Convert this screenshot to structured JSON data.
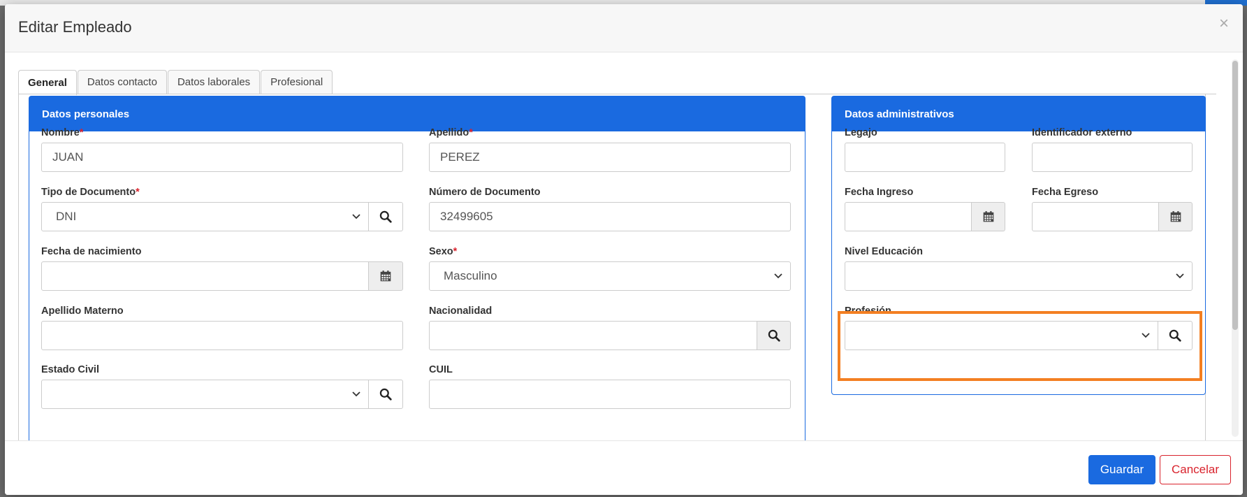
{
  "modal": {
    "title": "Editar Empleado",
    "close": "×"
  },
  "tabs": [
    "General",
    "Datos contacto",
    "Datos laborales",
    "Profesional"
  ],
  "personal": {
    "title": "Datos personales",
    "nombre": {
      "label": "Nombre",
      "required": "*",
      "value": "JUAN"
    },
    "apellido": {
      "label": "Apellido",
      "required": "*",
      "value": "PEREZ"
    },
    "tipo_documento": {
      "label": "Tipo de Documento",
      "required": "*",
      "value": "DNI"
    },
    "numero_documento": {
      "label": "Número de Documento",
      "value": "32499605"
    },
    "fecha_nacimiento": {
      "label": "Fecha de nacimiento",
      "value": ""
    },
    "sexo": {
      "label": "Sexo",
      "required": "*",
      "value": "Masculino"
    },
    "apellido_materno": {
      "label": "Apellido Materno",
      "value": ""
    },
    "nacionalidad": {
      "label": "Nacionalidad",
      "value": ""
    },
    "estado_civil": {
      "label": "Estado Civil",
      "value": ""
    },
    "cuil": {
      "label": "CUIL",
      "value": ""
    }
  },
  "admin": {
    "title": "Datos administrativos",
    "legajo": {
      "label": "Legajo",
      "value": ""
    },
    "identificador_externo": {
      "label": "Identificador externo",
      "value": ""
    },
    "fecha_ingreso": {
      "label": "Fecha Ingreso",
      "value": ""
    },
    "fecha_egreso": {
      "label": "Fecha Egreso",
      "value": ""
    },
    "nivel_educacion": {
      "label": "Nivel Educación",
      "value": ""
    },
    "profesion": {
      "label": "Profesión",
      "value": ""
    }
  },
  "footer": {
    "save": "Guardar",
    "cancel": "Cancelar"
  },
  "colors": {
    "primary": "#1a6ae0",
    "danger": "#d9232d",
    "highlight": "#f37f22"
  }
}
